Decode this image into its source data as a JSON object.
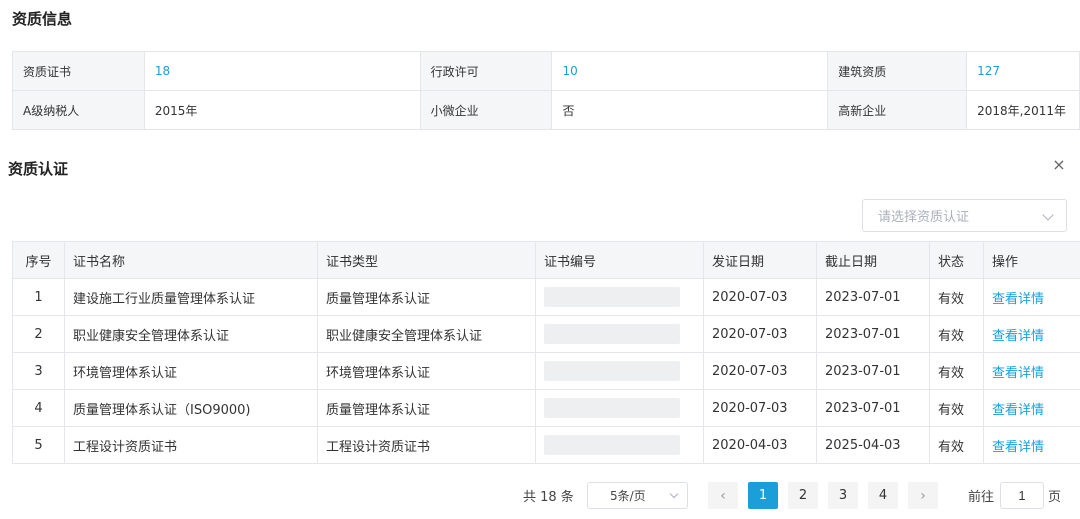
{
  "qualification_info": {
    "title": "资质信息",
    "rows": [
      [
        {
          "label": "资质证书",
          "value": "18",
          "link": true
        },
        {
          "label": "行政许可",
          "value": "10",
          "link": true
        },
        {
          "label": "建筑资质",
          "value": "127",
          "link": true
        }
      ],
      [
        {
          "label": "A级纳税人",
          "value": "2015年",
          "link": false
        },
        {
          "label": "小微企业",
          "value": "否",
          "link": false
        },
        {
          "label": "高新企业",
          "value": "2018年,2011年",
          "link": false
        }
      ]
    ]
  },
  "certification": {
    "title": "资质认证",
    "close_icon": "×",
    "select_placeholder": "请选择资质认证",
    "columns": [
      "序号",
      "证书名称",
      "证书类型",
      "证书编号",
      "发证日期",
      "截止日期",
      "状态",
      "操作"
    ],
    "rows": [
      {
        "no": "1",
        "name": "建设施工行业质量管理体系认证",
        "type": "质量管理体系认证",
        "issue_date": "2020-07-03",
        "expiry_date": "2023-07-01",
        "status": "有效",
        "action": "查看详情"
      },
      {
        "no": "2",
        "name": "职业健康安全管理体系认证",
        "type": "职业健康安全管理体系认证",
        "issue_date": "2020-07-03",
        "expiry_date": "2023-07-01",
        "status": "有效",
        "action": "查看详情"
      },
      {
        "no": "3",
        "name": "环境管理体系认证",
        "type": "环境管理体系认证",
        "issue_date": "2020-07-03",
        "expiry_date": "2023-07-01",
        "status": "有效",
        "action": "查看详情"
      },
      {
        "no": "4",
        "name": "质量管理体系认证（ISO9000)",
        "type": "质量管理体系认证",
        "issue_date": "2020-07-03",
        "expiry_date": "2023-07-01",
        "status": "有效",
        "action": "查看详情"
      },
      {
        "no": "5",
        "name": "工程设计资质证书",
        "type": "工程设计资质证书",
        "issue_date": "2020-04-03",
        "expiry_date": "2025-04-03",
        "status": "有效",
        "action": "查看详情"
      }
    ]
  },
  "pagination": {
    "total_text": "共 18 条",
    "page_size": "5条/页",
    "prev_icon": "‹",
    "next_icon": "›",
    "pages": [
      "1",
      "2",
      "3",
      "4"
    ],
    "current_page": "1",
    "jump_label": "前往",
    "jump_value": "1",
    "jump_unit": "页"
  },
  "colors": {
    "accent": "#1a9fd9",
    "header_bg": "#f5f6f8",
    "border": "#e4e6eb"
  }
}
